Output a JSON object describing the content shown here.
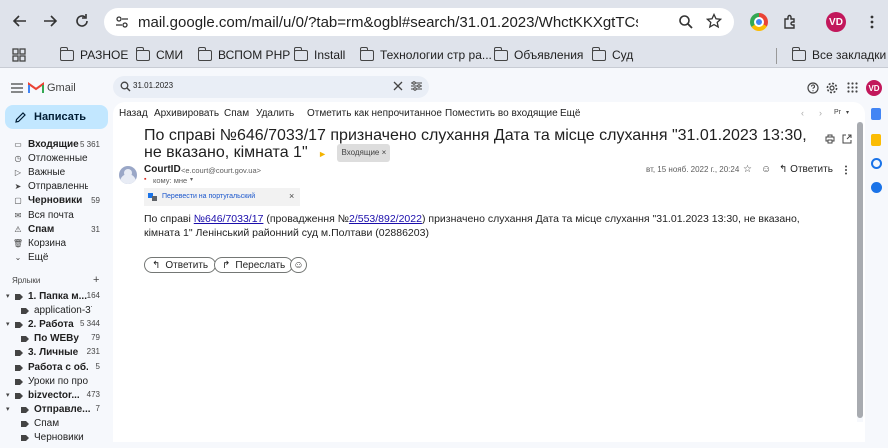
{
  "browser": {
    "url": "mail.google.com/mail/u/0/?tab=rm&ogbl#search/31.01.2023/WhctKKXgtTCsHHTlHBshJsFMggx...",
    "avatar_initials": "VD",
    "bookmarks": [
      "РАЗНОЕ",
      "СМИ",
      "ВСПОМ PHP",
      "Install",
      "Технологии стр ра...",
      "Объявления",
      "Суд"
    ],
    "all_bookmarks": "Все закладки"
  },
  "gmail": {
    "brand": "Gmail",
    "search_value": "31.01.2023",
    "avatar_initials": "VD",
    "compose_label": "Написать",
    "nav": [
      {
        "label": "Входящие",
        "count": "5 361",
        "bold": true,
        "selected": false
      },
      {
        "label": "Отложенные",
        "count": "",
        "bold": false,
        "selected": false
      },
      {
        "label": "Важные",
        "count": "",
        "bold": false,
        "selected": false
      },
      {
        "label": "Отправленные",
        "count": "",
        "bold": false,
        "selected": false
      },
      {
        "label": "Черновики",
        "count": "59",
        "bold": true,
        "selected": false
      },
      {
        "label": "Вся почта",
        "count": "",
        "bold": false,
        "selected": false
      },
      {
        "label": "Спам",
        "count": "31",
        "bold": true,
        "selected": false
      },
      {
        "label": "Корзина",
        "count": "",
        "bold": false,
        "selected": false
      },
      {
        "label": "Ещё",
        "count": "",
        "bold": false,
        "selected": false
      }
    ],
    "labels_header": "Ярлыки",
    "labels": [
      {
        "label": "1. Папка м...",
        "count": "164",
        "bold": true,
        "level": 0,
        "arrow": true
      },
      {
        "label": "application-37...",
        "count": "",
        "bold": false,
        "level": 1,
        "arrow": false
      },
      {
        "label": "2. Работа",
        "count": "5 344",
        "bold": true,
        "level": 0,
        "arrow": true
      },
      {
        "label": "По WEBу",
        "count": "79",
        "bold": true,
        "level": 1,
        "arrow": false
      },
      {
        "label": "3. Личные",
        "count": "231",
        "bold": true,
        "level": 0,
        "arrow": false
      },
      {
        "label": "Работа с об...",
        "count": "5",
        "bold": true,
        "level": 0,
        "arrow": false
      },
      {
        "label": "Уроки по прог...",
        "count": "",
        "bold": false,
        "level": 0,
        "arrow": false
      },
      {
        "label": "bizvector...",
        "count": "473",
        "bold": true,
        "level": 0,
        "arrow": true
      },
      {
        "label": "Отправле...",
        "count": "7",
        "bold": true,
        "level": 1,
        "arrow": true
      },
      {
        "label": "Спам",
        "count": "",
        "bold": false,
        "level": 1,
        "arrow": false
      },
      {
        "label": "Черновики",
        "count": "",
        "bold": false,
        "level": 1,
        "arrow": false
      }
    ],
    "toolbar": [
      "Назад",
      "Архивировать",
      "Спам",
      "Удалить",
      "Отметить как непрочитанное",
      "Поместить во входящие",
      "Ещё"
    ],
    "lang_badge": "Рг",
    "message": {
      "subject": "По справі №646/7033/17 призначено слухання Дата та місце слухання \"31.01.2023 13:30, не вказано, кімната 1\"",
      "inbox_tag": "Входящие ×",
      "sender_name": "CourtID",
      "sender_email": "<e.court@court.gov.ua>",
      "to_line": "кому: мне",
      "date": "вт, 15 нояб. 2022 г., 20:24",
      "reply_short": "Ответить",
      "translate_text": "Перевести на португальский",
      "body_prefix": "По справі ",
      "case_link": "646/7033/17",
      "body_mid": " (провадження №",
      "proc_link": "2/553/892/2022",
      "body_suffix": ") призначено слухання Дата та місце слухання \"31.01.2023 13:30, не вказано, кімната 1\" Ленінський районний суд м.Полтави (02886203)",
      "reply_button": "Ответить",
      "forward_button": "Переслать"
    }
  }
}
